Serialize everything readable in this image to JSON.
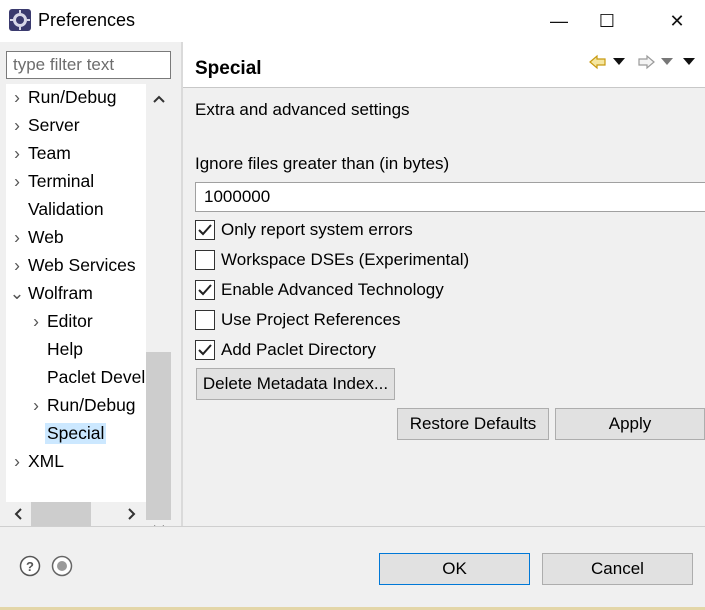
{
  "window": {
    "title": "Preferences",
    "minimize_glyph": "—",
    "maximize_glyph": "☐",
    "close_glyph": "✕"
  },
  "filter": {
    "placeholder": "type filter text",
    "value": ""
  },
  "tree": {
    "items": [
      {
        "label": "Run/Debug",
        "chevron": "›",
        "indent": 0
      },
      {
        "label": "Server",
        "chevron": "›",
        "indent": 0
      },
      {
        "label": "Team",
        "chevron": "›",
        "indent": 0
      },
      {
        "label": "Terminal",
        "chevron": "›",
        "indent": 0
      },
      {
        "label": "Validation",
        "chevron": "",
        "indent": 0
      },
      {
        "label": "Web",
        "chevron": "›",
        "indent": 0
      },
      {
        "label": "Web Services",
        "chevron": "›",
        "indent": 0
      },
      {
        "label": "Wolfram",
        "chevron": "⌄",
        "indent": 0
      },
      {
        "label": "Editor",
        "chevron": "›",
        "indent": 1
      },
      {
        "label": "Help",
        "chevron": "",
        "indent": 1
      },
      {
        "label": "Paclet Develo",
        "chevron": "",
        "indent": 1
      },
      {
        "label": "Run/Debug",
        "chevron": "›",
        "indent": 1
      },
      {
        "label": "Special",
        "chevron": "",
        "indent": 1,
        "selected": true
      },
      {
        "label": "XML",
        "chevron": "›",
        "indent": 0
      }
    ]
  },
  "page": {
    "title": "Special",
    "description": "Extra and advanced settings",
    "ignore_label": "Ignore files greater than (in bytes)",
    "ignore_value": "1000000",
    "checkboxes": [
      {
        "label": "Only report system errors",
        "checked": true
      },
      {
        "label": "Workspace DSEs (Experimental)",
        "checked": false
      },
      {
        "label": "Enable Advanced Technology",
        "checked": true
      },
      {
        "label": "Use Project References",
        "checked": false
      },
      {
        "label": "Add Paclet Directory",
        "checked": true
      }
    ],
    "delete_button": "Delete Metadata Index...",
    "restore_button": "Restore Defaults",
    "apply_button": "Apply"
  },
  "footer": {
    "ok_button": "OK",
    "cancel_button": "Cancel"
  },
  "colors": {
    "selection": "#cce8ff",
    "accent": "#0078d7",
    "nav_back": "#e0b020"
  }
}
